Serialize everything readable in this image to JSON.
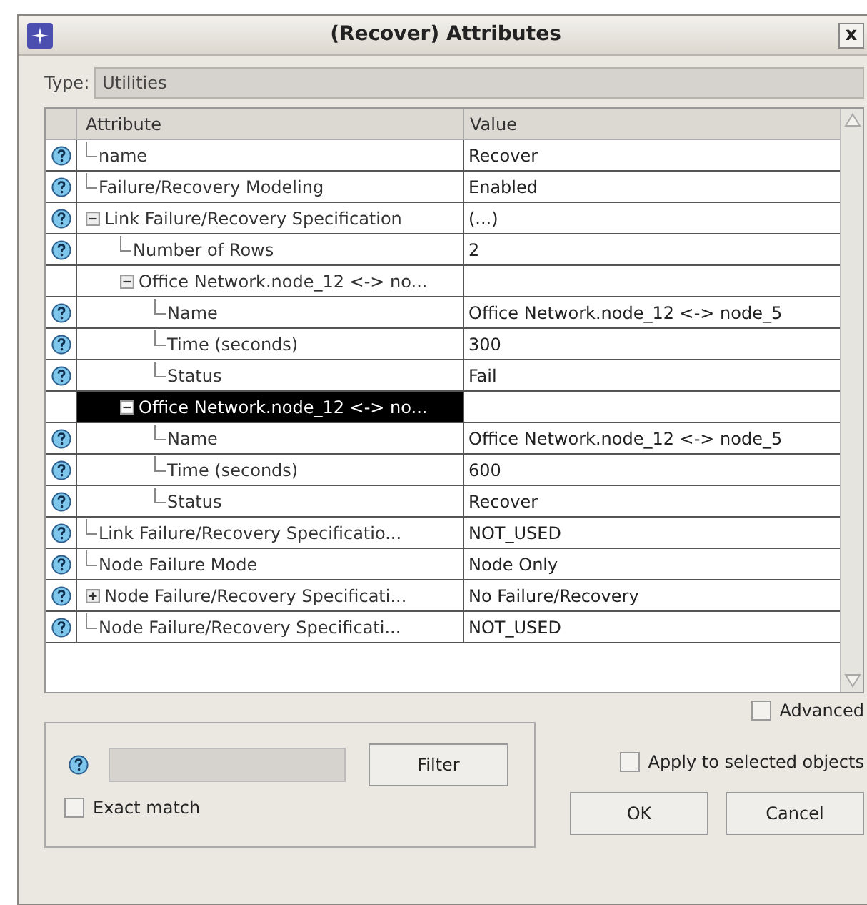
{
  "window": {
    "title": "(Recover) Attributes",
    "close": "x"
  },
  "type_field": {
    "label": "Type:",
    "value": "Utilities"
  },
  "table": {
    "columns": [
      "Attribute",
      "Value"
    ],
    "rows": [
      {
        "attribute": "name",
        "value": "Recover",
        "help": true,
        "selected": false
      },
      {
        "attribute": "Failure/Recovery Modeling",
        "value": "Enabled",
        "help": true,
        "selected": false
      },
      {
        "attribute": "Link Failure/Recovery Specification",
        "value": "(...)",
        "help": true,
        "selected": false,
        "expanded": true,
        "children": [
          {
            "attribute": "Number of Rows",
            "value": "2",
            "help": true,
            "selected": false
          },
          {
            "attribute": "Office Network.node_12 <-> no...",
            "help": false,
            "selected": false,
            "expanded": true,
            "children": [
              {
                "attribute": "Name",
                "value": "Office Network.node_12 <-> node_5",
                "help": true,
                "selected": false
              },
              {
                "attribute": "Time (seconds)",
                "value": "300",
                "help": true,
                "selected": false
              },
              {
                "attribute": "Status",
                "value": "Fail",
                "help": true,
                "selected": false
              }
            ]
          },
          {
            "attribute": "Office Network.node_12 <-> no...",
            "help": false,
            "selected": true,
            "expanded": true,
            "children": [
              {
                "attribute": "Name",
                "value": "Office Network.node_12 <-> node_5",
                "help": true,
                "selected": false
              },
              {
                "attribute": "Time (seconds)",
                "value": "600",
                "help": true,
                "selected": false
              },
              {
                "attribute": "Status",
                "value": "Recover",
                "help": true,
                "selected": false
              }
            ]
          }
        ]
      },
      {
        "attribute": "Link Failure/Recovery Specificatio...",
        "value": "NOT_USED",
        "help": true,
        "selected": false
      },
      {
        "attribute": "Node Failure Mode",
        "value": "Node Only",
        "help": true,
        "selected": false
      },
      {
        "attribute": "Node Failure/Recovery Specificati...",
        "value": "No Failure/Recovery",
        "help": true,
        "selected": false,
        "expanded": false
      },
      {
        "attribute": "Node Failure/Recovery Specificati...",
        "value": "NOT_USED",
        "help": true,
        "selected": false
      }
    ]
  },
  "filter": {
    "button": "Filter",
    "exact_match": {
      "label": "Exact match",
      "checked": false
    }
  },
  "advanced": {
    "label": "Advanced",
    "checked": false
  },
  "apply_to_selected": {
    "label": "Apply to selected objects",
    "checked": false
  },
  "buttons": [
    "OK",
    "Cancel"
  ]
}
